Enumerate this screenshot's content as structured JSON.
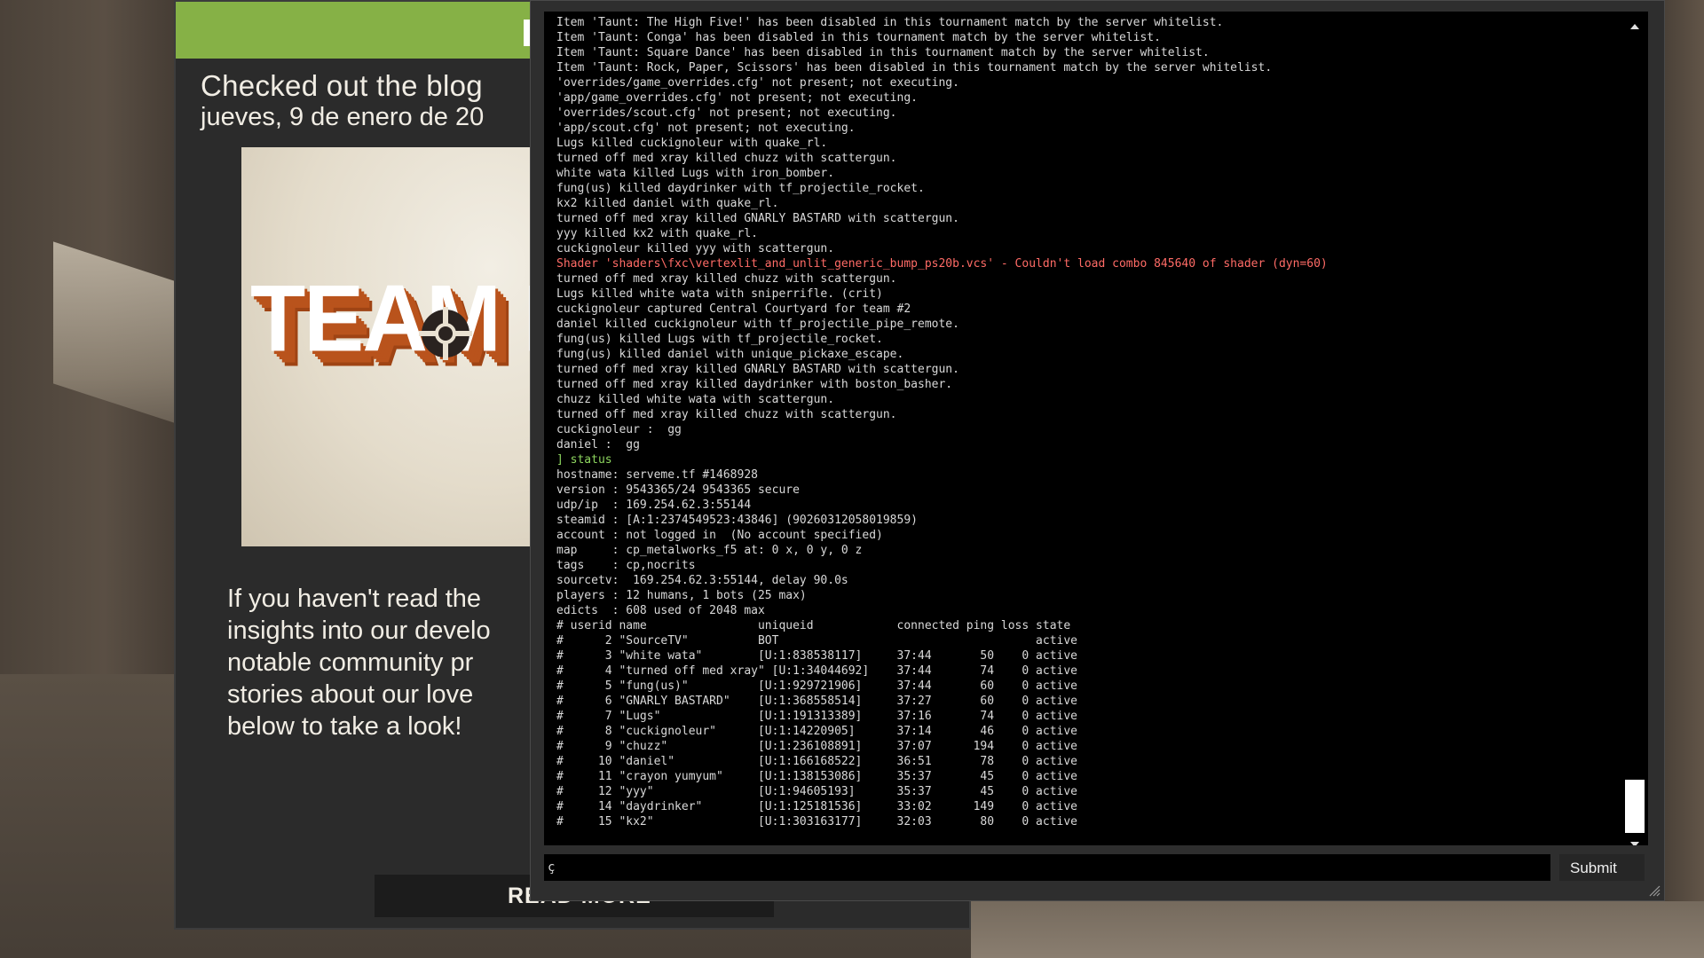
{
  "blog": {
    "title": "Checked out the blog",
    "date": "jueves, 9 de enero de 20",
    "logo_text": "TEAM FO",
    "paragraph_lines": [
      "If you haven't read the",
      "insights into our develo",
      "notable community pr",
      "stories about our love",
      "below to take a look!"
    ],
    "read_more_label": "READ MORE"
  },
  "console": {
    "lines": [
      {
        "text": "Item 'Taunt: The High Five!' has been disabled in this tournament match by the server whitelist.",
        "kind": "normal"
      },
      {
        "text": "Item 'Taunt: Conga' has been disabled in this tournament match by the server whitelist.",
        "kind": "normal"
      },
      {
        "text": "Item 'Taunt: Square Dance' has been disabled in this tournament match by the server whitelist.",
        "kind": "normal"
      },
      {
        "text": "Item 'Taunt: Rock, Paper, Scissors' has been disabled in this tournament match by the server whitelist.",
        "kind": "normal"
      },
      {
        "text": "'overrides/game_overrides.cfg' not present; not executing.",
        "kind": "normal"
      },
      {
        "text": "'app/game_overrides.cfg' not present; not executing.",
        "kind": "normal"
      },
      {
        "text": "'overrides/scout.cfg' not present; not executing.",
        "kind": "normal"
      },
      {
        "text": "'app/scout.cfg' not present; not executing.",
        "kind": "normal"
      },
      {
        "text": "Lugs killed cuckignoleur with quake_rl.",
        "kind": "normal"
      },
      {
        "text": "turned off med xray killed chuzz with scattergun.",
        "kind": "normal"
      },
      {
        "text": "white wata killed Lugs with iron_bomber.",
        "kind": "normal"
      },
      {
        "text": "fung(us) killed daydrinker with tf_projectile_rocket.",
        "kind": "normal"
      },
      {
        "text": "kx2 killed daniel with quake_rl.",
        "kind": "normal"
      },
      {
        "text": "turned off med xray killed GNARLY BASTARD with scattergun.",
        "kind": "normal"
      },
      {
        "text": "yyy killed kx2 with quake_rl.",
        "kind": "normal"
      },
      {
        "text": "cuckignoleur killed yyy with scattergun.",
        "kind": "normal"
      },
      {
        "text": "Shader 'shaders\\fxc\\vertexlit_and_unlit_generic_bump_ps20b.vcs' - Couldn't load combo 845640 of shader (dyn=60)",
        "kind": "error"
      },
      {
        "text": "turned off med xray killed chuzz with scattergun.",
        "kind": "normal"
      },
      {
        "text": "Lugs killed white wata with sniperrifle. (crit)",
        "kind": "normal"
      },
      {
        "text": "cuckignoleur captured Central Courtyard for team #2",
        "kind": "normal"
      },
      {
        "text": "daniel killed cuckignoleur with tf_projectile_pipe_remote.",
        "kind": "normal"
      },
      {
        "text": "fung(us) killed Lugs with tf_projectile_rocket.",
        "kind": "normal"
      },
      {
        "text": "fung(us) killed daniel with unique_pickaxe_escape.",
        "kind": "normal"
      },
      {
        "text": "turned off med xray killed GNARLY BASTARD with scattergun.",
        "kind": "normal"
      },
      {
        "text": "turned off med xray killed daydrinker with boston_basher.",
        "kind": "normal"
      },
      {
        "text": "chuzz killed white wata with scattergun.",
        "kind": "normal"
      },
      {
        "text": "turned off med xray killed chuzz with scattergun.",
        "kind": "normal"
      },
      {
        "text": "cuckignoleur :  gg",
        "kind": "normal"
      },
      {
        "text": "daniel :  gg",
        "kind": "normal"
      },
      {
        "text": "] status",
        "kind": "command"
      },
      {
        "text": "hostname: serveme.tf #1468928",
        "kind": "normal"
      },
      {
        "text": "version : 9543365/24 9543365 secure",
        "kind": "normal"
      },
      {
        "text": "udp/ip  : 169.254.62.3:55144",
        "kind": "normal"
      },
      {
        "text": "steamid : [A:1:2374549523:43846] (90260312058019859)",
        "kind": "normal"
      },
      {
        "text": "account : not logged in  (No account specified)",
        "kind": "normal"
      },
      {
        "text": "map     : cp_metalworks_f5 at: 0 x, 0 y, 0 z",
        "kind": "normal"
      },
      {
        "text": "tags    : cp,nocrits",
        "kind": "normal"
      },
      {
        "text": "sourcetv:  169.254.62.3:55144, delay 90.0s",
        "kind": "normal"
      },
      {
        "text": "players : 12 humans, 1 bots (25 max)",
        "kind": "normal"
      },
      {
        "text": "edicts  : 608 used of 2048 max",
        "kind": "normal"
      },
      {
        "text": "# userid name                uniqueid            connected ping loss state",
        "kind": "normal"
      },
      {
        "text": "#      2 \"SourceTV\"          BOT                                     active",
        "kind": "normal"
      },
      {
        "text": "#      3 \"white wata\"        [U:1:838538117]     37:44       50    0 active",
        "kind": "normal"
      },
      {
        "text": "#      4 \"turned off med xray\" [U:1:34044692]    37:44       74    0 active",
        "kind": "normal"
      },
      {
        "text": "#      5 \"fung(us)\"          [U:1:929721906]     37:44       60    0 active",
        "kind": "normal"
      },
      {
        "text": "#      6 \"GNARLY BASTARD\"    [U:1:368558514]     37:27       60    0 active",
        "kind": "normal"
      },
      {
        "text": "#      7 \"Lugs\"              [U:1:191313389]     37:16       74    0 active",
        "kind": "normal"
      },
      {
        "text": "#      8 \"cuckignoleur\"      [U:1:14220905]      37:14       46    0 active",
        "kind": "normal"
      },
      {
        "text": "#      9 \"chuzz\"             [U:1:236108891]     37:07      194    0 active",
        "kind": "normal"
      },
      {
        "text": "#     10 \"daniel\"            [U:1:166168522]     36:51       78    0 active",
        "kind": "normal"
      },
      {
        "text": "#     11 \"crayon yumyum\"     [U:1:138153086]     35:37       45    0 active",
        "kind": "normal"
      },
      {
        "text": "#     12 \"yyy\"               [U:1:94605193]      35:37       45    0 active",
        "kind": "normal"
      },
      {
        "text": "#     14 \"daydrinker\"        [U:1:125181536]     33:02      149    0 active",
        "kind": "normal"
      },
      {
        "text": "#     15 \"kx2\"               [U:1:303163177]     32:03       80    0 active",
        "kind": "normal"
      }
    ],
    "input_value": "ç",
    "submit_label": "Submit",
    "scroll_position": 0.95
  },
  "colors": {
    "text": "#d9d9d9",
    "error": "#ff6b66",
    "command": "#8ed65f",
    "accent_green": "#86b146",
    "logo_orange": "#b9531c"
  }
}
